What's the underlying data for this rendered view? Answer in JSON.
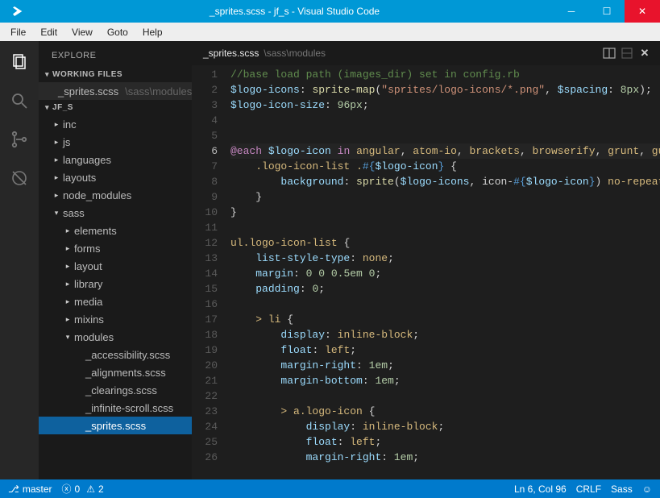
{
  "window": {
    "title": "_sprites.scss - jf_s - Visual Studio Code"
  },
  "menu": {
    "items": [
      "File",
      "Edit",
      "View",
      "Goto",
      "Help"
    ]
  },
  "sidebar": {
    "title": "EXPLORE",
    "workingFilesHeader": "WORKING FILES",
    "workingFile": {
      "name": "_sprites.scss",
      "path": "\\sass\\modules"
    },
    "projectHeader": "JF_S",
    "tree": [
      {
        "label": "inc",
        "depth": 1,
        "icon": "right"
      },
      {
        "label": "js",
        "depth": 1,
        "icon": "right"
      },
      {
        "label": "languages",
        "depth": 1,
        "icon": "right"
      },
      {
        "label": "layouts",
        "depth": 1,
        "icon": "right"
      },
      {
        "label": "node_modules",
        "depth": 1,
        "icon": "right"
      },
      {
        "label": "sass",
        "depth": 1,
        "icon": "down"
      },
      {
        "label": "elements",
        "depth": 2,
        "icon": "right"
      },
      {
        "label": "forms",
        "depth": 2,
        "icon": "right"
      },
      {
        "label": "layout",
        "depth": 2,
        "icon": "right"
      },
      {
        "label": "library",
        "depth": 2,
        "icon": "right"
      },
      {
        "label": "media",
        "depth": 2,
        "icon": "right"
      },
      {
        "label": "mixins",
        "depth": 2,
        "icon": "right"
      },
      {
        "label": "modules",
        "depth": 2,
        "icon": "down"
      },
      {
        "label": "_accessibility.scss",
        "depth": 3,
        "icon": "none"
      },
      {
        "label": "_alignments.scss",
        "depth": 3,
        "icon": "none"
      },
      {
        "label": "_clearings.scss",
        "depth": 3,
        "icon": "none"
      },
      {
        "label": "_infinite-scroll.scss",
        "depth": 3,
        "icon": "none"
      },
      {
        "label": "_sprites.scss",
        "depth": 3,
        "icon": "none",
        "highlight": true
      }
    ]
  },
  "tab": {
    "name": "_sprites.scss",
    "path": "\\sass\\modules"
  },
  "code": {
    "lines": [
      {
        "n": 1,
        "html": "<span class='c-comment'>//base load path (images_dir) set in config.rb</span>"
      },
      {
        "n": 2,
        "html": "<span class='c-var'>$logo-icons</span>: <span class='c-func'>sprite-map</span>(<span class='c-str'>\"sprites/logo-icons/*.png\"</span>, <span class='c-var'>$spacing</span>: <span class='c-num'>8px</span>);"
      },
      {
        "n": 3,
        "html": "<span class='c-var'>$logo-icon-size</span>: <span class='c-num'>96px</span>;"
      },
      {
        "n": 4,
        "html": ""
      },
      {
        "n": 5,
        "html": ""
      },
      {
        "n": 6,
        "cur": true,
        "html": "<span class='c-kw'>@each</span> <span class='c-var'>$logo-icon</span> <span class='c-kw'>in</span> <span class='c-sel'>angular</span>, <span class='c-sel'>atom-io</span>, <span class='c-sel'>brackets</span>, <span class='c-sel'>browserify</span>, <span class='c-sel'>grunt</span>, <span class='c-sel'>gu</span>"
      },
      {
        "n": 7,
        "html": "    <span class='c-sel'>.logo-icon-list</span> <span class='c-sel'>.</span><span class='c-interp'>#{</span><span class='c-var'>$logo-icon</span><span class='c-interp'>}</span> <span class='c-punc'>{</span>"
      },
      {
        "n": 8,
        "html": "        <span class='c-prop'>background</span>: <span class='c-func'>sprite</span>(<span class='c-var'>$logo-icons</span>, icon-<span class='c-interp'>#{</span><span class='c-var'>$logo-icon</span><span class='c-interp'>}</span>) <span class='c-sel'>no-repeat</span>"
      },
      {
        "n": 9,
        "html": "    <span class='c-punc'>}</span>"
      },
      {
        "n": 10,
        "html": "<span class='c-punc'>}</span>"
      },
      {
        "n": 11,
        "html": ""
      },
      {
        "n": 12,
        "html": "<span class='c-sel'>ul.logo-icon-list</span> <span class='c-punc'>{</span>"
      },
      {
        "n": 13,
        "html": "    <span class='c-prop'>list-style-type</span>: <span class='c-sel'>none</span>;"
      },
      {
        "n": 14,
        "html": "    <span class='c-prop'>margin</span>: <span class='c-num'>0 0 0.5em 0</span>;"
      },
      {
        "n": 15,
        "html": "    <span class='c-prop'>padding</span>: <span class='c-num'>0</span>;"
      },
      {
        "n": 16,
        "html": ""
      },
      {
        "n": 17,
        "html": "    <span class='c-sel'>&gt; li</span> <span class='c-punc'>{</span>"
      },
      {
        "n": 18,
        "html": "        <span class='c-prop'>display</span>: <span class='c-sel'>inline-block</span>;"
      },
      {
        "n": 19,
        "html": "        <span class='c-prop'>float</span>: <span class='c-sel'>left</span>;"
      },
      {
        "n": 20,
        "html": "        <span class='c-prop'>margin-right</span>: <span class='c-num'>1em</span>;"
      },
      {
        "n": 21,
        "html": "        <span class='c-prop'>margin-bottom</span>: <span class='c-num'>1em</span>;"
      },
      {
        "n": 22,
        "html": ""
      },
      {
        "n": 23,
        "html": "        <span class='c-sel'>&gt; a.logo-icon</span> <span class='c-punc'>{</span>"
      },
      {
        "n": 24,
        "html": "            <span class='c-prop'>display</span>: <span class='c-sel'>inline-block</span>;"
      },
      {
        "n": 25,
        "html": "            <span class='c-prop'>float</span>: <span class='c-sel'>left</span>;"
      },
      {
        "n": 26,
        "html": "            <span class='c-prop'>margin-right</span>: <span class='c-num'>1em</span>;"
      }
    ]
  },
  "status": {
    "branchIcon": "⎇",
    "branch": "master",
    "errors": "0",
    "warnings": "2",
    "position": "Ln 6, Col 96",
    "eol": "CRLF",
    "lang": "Sass",
    "smile": "☺"
  }
}
